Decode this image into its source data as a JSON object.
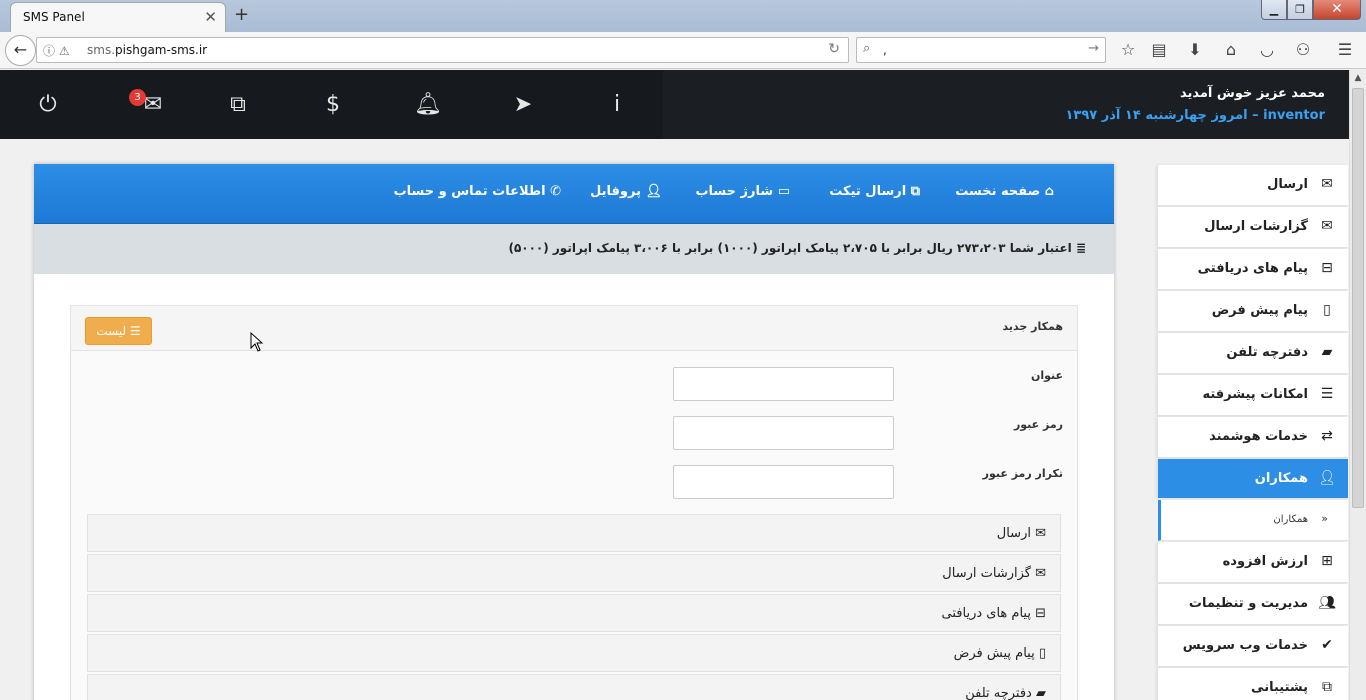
{
  "browser": {
    "tab_title": "SMS Panel",
    "url_host_prefix": "sms.",
    "url_host_main": "pishgam-sms.ir",
    "search_value": ","
  },
  "header": {
    "welcome": "محمد عزیز خوش آمدید",
    "username": "inventor",
    "separator": "–",
    "date_text": "امروز چهارشنبه ۱۴ آذر ۱۳۹۷",
    "message_count": "3",
    "icons": [
      "power-icon",
      "envelope-icon",
      "ticket-icon",
      "dollar-icon",
      "bell-icon",
      "paper-plane-icon",
      "info-icon"
    ]
  },
  "topnav": {
    "home": "صفحه نخست",
    "ticket": "ارسال تیکت",
    "charge": "شارژ حساب",
    "profile": "پروفایل",
    "contact": "اطلاعات تماس و حساب"
  },
  "credit": {
    "text": "اعتبار شما ۲۷۳،۲۰۳ ریال برابر با ۲،۷۰۵ پیامک اپراتور (۱۰۰۰) برابر با ۳،۰۰۶ پیامک اپراتور (۵۰۰۰)"
  },
  "form": {
    "title": "همکار جدید",
    "list_button": "لیست",
    "fields": {
      "title_label": "عنوان",
      "password_label": "رمز عبور",
      "password_repeat_label": "تکرار رمز عبور"
    }
  },
  "menu_rows": [
    {
      "label": "ارسال"
    },
    {
      "label": "گزارشات ارسال"
    },
    {
      "label": "پیام های دریافتی"
    },
    {
      "label": "پیام پیش فرض"
    },
    {
      "label": "دفترچه تلفن"
    }
  ],
  "sidebar": {
    "items": [
      {
        "label": "ارسال"
      },
      {
        "label": "گزارشات ارسال"
      },
      {
        "label": "پیام های دریافتی"
      },
      {
        "label": "پیام پیش فرض"
      },
      {
        "label": "دفترچه تلفن"
      },
      {
        "label": "امکانات پیشرفته"
      },
      {
        "label": "خدمات هوشمند"
      },
      {
        "label": "همکاران"
      },
      {
        "label": "ارزش افزوده"
      },
      {
        "label": "مدیریت و تنظیمات"
      },
      {
        "label": "خدمات وب سرویس"
      },
      {
        "label": "پشتیبانی"
      }
    ],
    "sub_item": "همکاران",
    "accent": "#2d8ee6"
  }
}
